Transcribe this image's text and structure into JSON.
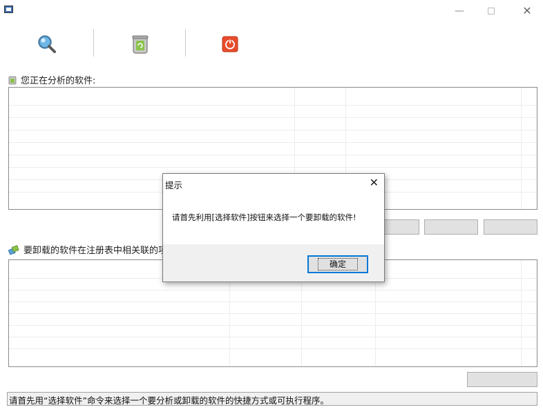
{
  "window": {
    "minimize_glyph": "—",
    "close_glyph": "✕"
  },
  "toolbar": {
    "buttons": [
      {
        "icon": "magnifier-icon"
      },
      {
        "icon": "recycle-bin-icon"
      },
      {
        "icon": "power-icon"
      }
    ]
  },
  "analysis_section": {
    "title": "您正在分析的软件:"
  },
  "registry_section": {
    "title": "要卸载的软件在注册表中相关联的项"
  },
  "status_bar": {
    "text": "请首先用“选择软件”命令来选择一个要分析或卸载的软件的快捷方式或可执行程序。"
  },
  "dialog": {
    "title": "提示",
    "close_glyph": "✕",
    "message": "请首先利用[选择软件]按钮来选择一个要卸载的软件!",
    "ok_label": "确定"
  },
  "colors": {
    "power_icon_bg": "#e84c2b",
    "magnifier_lens": "#6fb7e6",
    "bin_green": "#8bc34a",
    "focus_border": "#0078d7"
  }
}
